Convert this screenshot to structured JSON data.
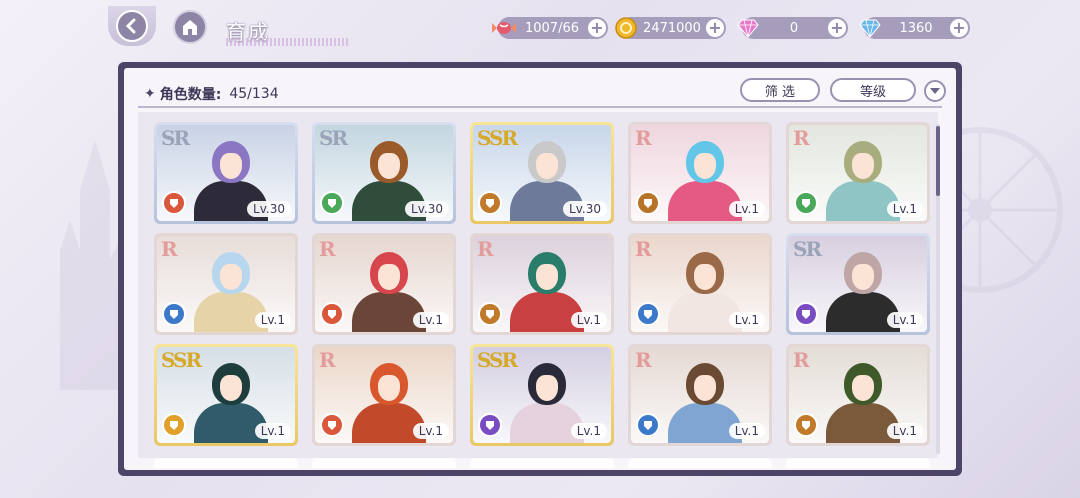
{
  "header": {
    "title": "育成",
    "resources": [
      {
        "name": "candy",
        "value": "1007/66",
        "icon": "candy-icon",
        "color": "#e65b6b"
      },
      {
        "name": "gold",
        "value": "2471000",
        "icon": "gold-coin-icon",
        "color": "#f1b82a"
      },
      {
        "name": "pink-diamond",
        "value": "0",
        "icon": "pink-diamond-icon",
        "color": "#e679c9"
      },
      {
        "name": "blue-diamond",
        "value": "1360",
        "icon": "blue-diamond-icon",
        "color": "#6bb6e8"
      }
    ]
  },
  "panel": {
    "count_label": "角色数量:",
    "count_value": "45/134",
    "filter_label": "筛 选",
    "sort_label": "等级"
  },
  "cards": [
    {
      "rarity": "SR",
      "level": "Lv.30",
      "attr_color": "#d9573a",
      "hair": "#8a76c2",
      "bg": "#c9d3e6",
      "outfit": "#2d2a3a"
    },
    {
      "rarity": "SR",
      "level": "Lv.30",
      "attr_color": "#4aa85a",
      "hair": "#9a5a2a",
      "bg": "#c3d6e0",
      "outfit": "#2f4d3a"
    },
    {
      "rarity": "SSR",
      "level": "Lv.30",
      "attr_color": "#c07a2a",
      "hair": "#c9c9c9",
      "bg": "#c8d6ea",
      "outfit": "#6e7a9a"
    },
    {
      "rarity": "R",
      "level": "Lv.1",
      "attr_color": "#b8752a",
      "hair": "#62c6e8",
      "bg": "#efd6df",
      "outfit": "#e45a83"
    },
    {
      "rarity": "R",
      "level": "Lv.1",
      "attr_color": "#4aa85a",
      "hair": "#a7ad7c",
      "bg": "#e3e7df",
      "outfit": "#8fc5c4"
    },
    {
      "rarity": "R",
      "level": "Lv.1",
      "attr_color": "#3c7ac9",
      "hair": "#b6d7ee",
      "bg": "#e7ddd9",
      "outfit": "#e6d3a8"
    },
    {
      "rarity": "R",
      "level": "Lv.1",
      "attr_color": "#d9573a",
      "hair": "#d8464d",
      "bg": "#e6d6d0",
      "outfit": "#6b4538"
    },
    {
      "rarity": "R",
      "level": "Lv.1",
      "attr_color": "#c07a2a",
      "hair": "#2a7d6a",
      "bg": "#dcd1dc",
      "outfit": "#c94040"
    },
    {
      "rarity": "R",
      "level": "Lv.1",
      "attr_color": "#3c7ac9",
      "hair": "#9a6a48",
      "bg": "#ead7cd",
      "outfit": "#f2e6e3"
    },
    {
      "rarity": "SR",
      "level": "Lv.1",
      "attr_color": "#7a4cc2",
      "hair": "#bfa6a6",
      "bg": "#d7cfe0",
      "outfit": "#2c2c2c"
    },
    {
      "rarity": "SSR",
      "level": "Lv.1",
      "attr_color": "#e0a02a",
      "hair": "#1e3e3e",
      "bg": "#d6dfe6",
      "outfit": "#2f5b6a"
    },
    {
      "rarity": "R",
      "level": "Lv.1",
      "attr_color": "#d9573a",
      "hair": "#d8572c",
      "bg": "#ebd7c9",
      "outfit": "#c04a2a"
    },
    {
      "rarity": "SSR",
      "level": "Lv.1",
      "attr_color": "#7a4cc2",
      "hair": "#2a2a3a",
      "bg": "#d4cfe2",
      "outfit": "#e6d2dc"
    },
    {
      "rarity": "R",
      "level": "Lv.1",
      "attr_color": "#3c7ac9",
      "hair": "#6a4a32",
      "bg": "#e5d9d3",
      "outfit": "#7fa6d2"
    },
    {
      "rarity": "R",
      "level": "Lv.1",
      "attr_color": "#c07a2a",
      "hair": "#3f5a2a",
      "bg": "#e3ddd6",
      "outfit": "#7a5a3a"
    }
  ]
}
